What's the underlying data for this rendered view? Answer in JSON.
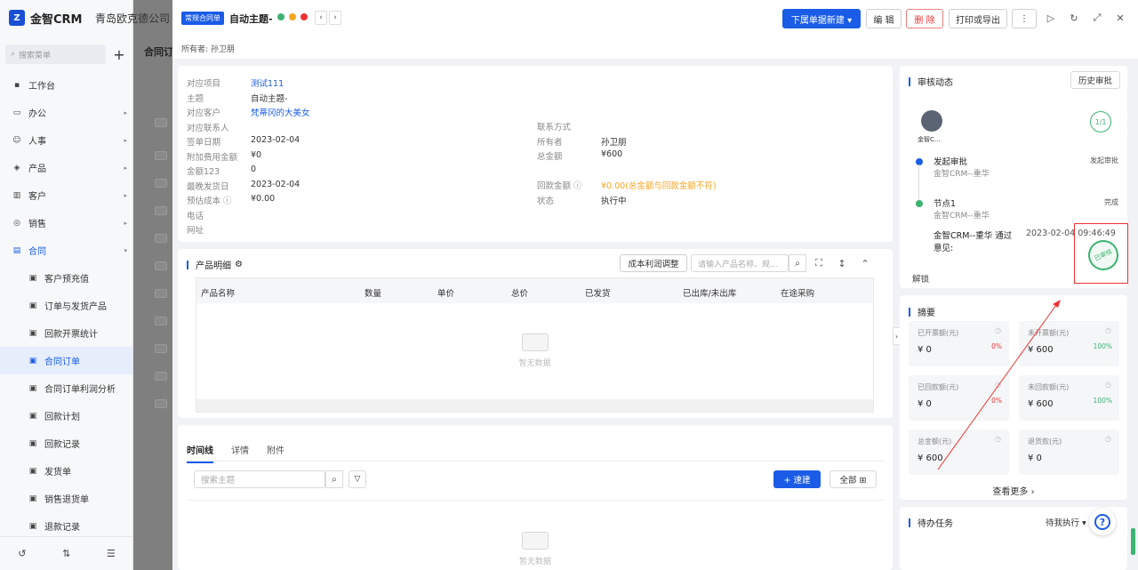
{
  "app": {
    "name": "金智CRM",
    "company": "青岛欧克德公司",
    "bg_tab": "合同订"
  },
  "sidebar": {
    "search_placeholder": "搜索菜单",
    "items": [
      {
        "label": "工作台",
        "icon": "dashboard-icon",
        "arrow": ""
      },
      {
        "label": "办公",
        "icon": "office-icon",
        "arrow": "▸"
      },
      {
        "label": "人事",
        "icon": "people-icon",
        "arrow": "▸"
      },
      {
        "label": "产品",
        "icon": "product-icon",
        "arrow": "▸"
      },
      {
        "label": "客户",
        "icon": "customer-icon",
        "arrow": "▸"
      },
      {
        "label": "销售",
        "icon": "sales-icon",
        "arrow": "▸"
      },
      {
        "label": "合同",
        "icon": "contract-icon",
        "arrow": "▾"
      }
    ],
    "subitems": [
      {
        "label": "客户预充值"
      },
      {
        "label": "订单与发货产品"
      },
      {
        "label": "回款开票统计"
      },
      {
        "label": "合同订单"
      },
      {
        "label": "合同订单利润分析"
      },
      {
        "label": "回款计划"
      },
      {
        "label": "回款记录"
      },
      {
        "label": "发货单"
      },
      {
        "label": "销售退货单"
      },
      {
        "label": "退款记录"
      }
    ]
  },
  "header": {
    "tag": "常规合同单",
    "title": "自动主题-",
    "owner_label": "所有者:",
    "owner": "孙卫朋",
    "btn_new": "下属单据新建 ▾",
    "btn_edit": "编 辑",
    "btn_delete": "删 除",
    "btn_print": "打印或导出",
    "btn_more": "⋮"
  },
  "info": {
    "left": [
      {
        "k": "对应项目",
        "v": "测试111",
        "style": "link"
      },
      {
        "k": "主题",
        "v": "自动主题-",
        "style": ""
      },
      {
        "k": "对应客户",
        "v": "梵蒂冈的大美女",
        "style": "link"
      },
      {
        "k": "对应联系人",
        "v": "",
        "style": ""
      },
      {
        "k": "签单日期",
        "v": "2023-02-04",
        "style": ""
      },
      {
        "k": "附加费用金额",
        "v": "¥0",
        "style": ""
      },
      {
        "k": "金额123",
        "v": "0",
        "style": ""
      },
      {
        "k": "最晚发货日",
        "v": "2023-02-04",
        "style": ""
      },
      {
        "k": "预估成本 ⓘ",
        "v": "¥0.00",
        "style": ""
      },
      {
        "k": "电话",
        "v": "",
        "style": ""
      },
      {
        "k": "网址",
        "v": "",
        "style": ""
      }
    ],
    "right": [
      {
        "k": "联系方式",
        "v": "",
        "style": ""
      },
      {
        "k": "所有者",
        "v": "孙卫朋",
        "style": ""
      },
      {
        "k": "总金额",
        "v": "¥600",
        "style": ""
      },
      {
        "k": "",
        "v": "",
        "style": ""
      },
      {
        "k": "回款金额 ⓘ",
        "v": "¥0.00(总金额与回款金额不符)",
        "style": "orange"
      },
      {
        "k": "状态",
        "v": "执行中",
        "style": ""
      }
    ]
  },
  "products": {
    "title": "产品明细",
    "btn_adjust": "成本利润调整",
    "search_placeholder": "请输入产品名称、规...",
    "columns": [
      "产品名称",
      "数量",
      "单价",
      "总价",
      "已发货",
      "已出库/未出库",
      "在途采购"
    ],
    "empty": "暂无数据"
  },
  "timeline": {
    "tabs": [
      "时间线",
      "详情",
      "附件"
    ],
    "search_placeholder": "搜索主题",
    "btn_quick": "+ 速建",
    "btn_all": "全部 ⊞",
    "empty": "暂无数据"
  },
  "approval": {
    "title": "审核动态",
    "btn_history": "历史审批",
    "avatar_name": "金智C...",
    "count": "1/1",
    "steps": [
      {
        "title": "发起审批",
        "sub": "金智CRM--重华",
        "right": "发起审批"
      },
      {
        "title": "节点1",
        "sub": "金智CRM--重华",
        "right": "完成"
      }
    ],
    "result_line": "金智CRM--重华 通过",
    "result_time": "2023-02-04 09:46:49",
    "opinion": "意见:",
    "stamp": "已审核",
    "unlock": "解锁"
  },
  "summary": {
    "title": "摘要",
    "cards": [
      {
        "label": "已开票额(元)",
        "value": "¥ 0",
        "pct": "0%",
        "pct_color": "#e33"
      },
      {
        "label": "未开票额(元)",
        "value": "¥ 600",
        "pct": "100%",
        "pct_color": "#3cb371"
      },
      {
        "label": "已回款额(元)",
        "value": "¥ 0",
        "pct": "0%",
        "pct_color": "#e33"
      },
      {
        "label": "未回款额(元)",
        "value": "¥ 600",
        "pct": "100%",
        "pct_color": "#3cb371"
      },
      {
        "label": "总金额(元)",
        "value": "¥ 600",
        "pct": "",
        "pct_color": ""
      },
      {
        "label": "退货款(元)",
        "value": "¥ 0",
        "pct": "",
        "pct_color": ""
      }
    ],
    "more": "查看更多 ›"
  },
  "todo": {
    "title": "待办任务",
    "filter": "待我执行 ▾"
  },
  "colors": {
    "accent": "#1a5ce6",
    "danger": "#e33",
    "success": "#3cb371",
    "warning": "#f5a623"
  }
}
